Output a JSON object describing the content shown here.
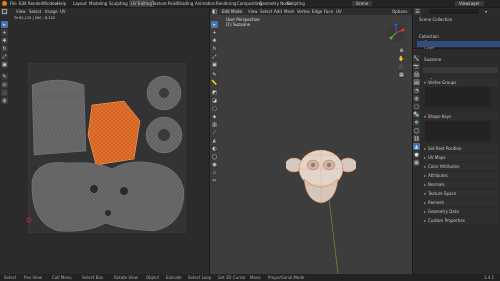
{
  "menubar": {
    "file": "File",
    "edit": "Edit",
    "render": "Render",
    "window": "Window",
    "help": "Help",
    "workspace_tabs": [
      "Layout",
      "Modeling",
      "Sculpting",
      "UV Editing",
      "Texture Paint",
      "Shading",
      "Animation",
      "Rendering",
      "Compositing",
      "Geometry Nodes",
      "Scripting"
    ],
    "active_tab": "UV Editing",
    "scene": "Scene",
    "view_layer": "ViewLayer"
  },
  "uv_editor": {
    "view_label": "View",
    "select_label": "Select",
    "image_label": "Image",
    "uv_label": "UV",
    "info_line": "Tri 61,115 | 200 ; 8,120"
  },
  "viewport": {
    "mode": "Edit Mode",
    "view_label": "View",
    "select_label": "Select",
    "add_label": "Add",
    "mesh_label": "Mesh",
    "vertex_label": "Vertex",
    "edge_label": "Edge",
    "face_label": "Face",
    "uv_label": "UV",
    "perspective": "User Perspective",
    "object_name": "(1) Suzanne",
    "global": "Global",
    "options": "Options"
  },
  "outliner": {
    "title": "Scene Collection",
    "items": [
      {
        "label": "Collection"
      },
      {
        "label": "Camera"
      },
      {
        "label": "Light"
      },
      {
        "label": "Suzanne"
      }
    ]
  },
  "properties": {
    "object_name": "Suzanne",
    "mesh_name": "Suzanne",
    "sections": [
      {
        "label": "Vertex Groups"
      },
      {
        "label": "Shape Keys"
      },
      {
        "label": "Set Rest Position"
      },
      {
        "label": "UV Maps"
      },
      {
        "label": "Color Attributes"
      },
      {
        "label": "Attributes"
      },
      {
        "label": "Normals"
      },
      {
        "label": "Texture Space"
      },
      {
        "label": "Remesh"
      },
      {
        "label": "Geometry Data"
      },
      {
        "label": "Custom Properties"
      }
    ]
  },
  "statusbar": {
    "items": [
      "Select",
      "Pan View",
      "Call Menu",
      "Select Box",
      "Rotate View",
      "Object",
      "Extrude",
      "Select Loop",
      "Set 3D Cursor",
      "Move",
      "Proportional Mode"
    ],
    "version": "3.4.1"
  },
  "colors": {
    "accent": "#4772b3",
    "selection_orange": "#e0702c",
    "uv_mesh_gray": "#6a6a6a"
  }
}
